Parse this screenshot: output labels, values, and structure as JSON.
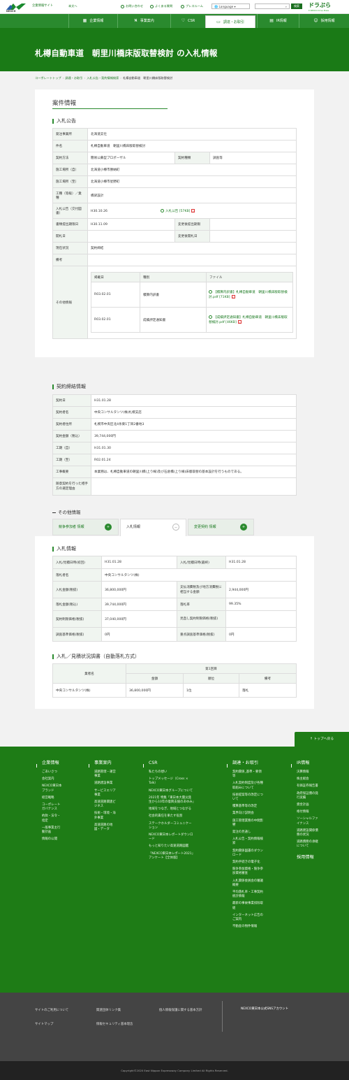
{
  "header": {
    "logo_text": "NEXCO",
    "corp_site": "企業情報サイト",
    "home": "本文へ",
    "util": [
      "お問い合わせ",
      "よくある質問",
      "プレスルーム"
    ],
    "language": "Language",
    "search_button": "検索",
    "drapura": "ドラぷら",
    "drapura_sub": "E-NEXCO Drive Plaza"
  },
  "nav": [
    {
      "label": "企業情報",
      "icon": "▦"
    },
    {
      "label": "事業案内",
      "icon": "⛕"
    },
    {
      "label": "CSR",
      "icon": "♡"
    },
    {
      "label": "調達・お取引",
      "icon": "▭"
    },
    {
      "label": "IR情報",
      "icon": "▤"
    },
    {
      "label": "採用情報",
      "icon": "☺"
    }
  ],
  "page": {
    "title": "札樽自動車道　朝里川橋床版取替検討 の入札情報",
    "breadcrumb": [
      "コーポレートトップ",
      "調達・お取引",
      "入札公告・契約情報検索",
      "札樽自動車道　朝里川橋床版取替検討"
    ]
  },
  "case": {
    "heading": "案件情報",
    "sub": "入札公告",
    "rows": [
      {
        "label": "発注事業所",
        "value": "北海道支社"
      },
      {
        "label": "件名",
        "value": "札樽自動車道　朝里川橋床版取替検討"
      },
      {
        "label": "契約方法",
        "value": "簡易公募型プロポーザル",
        "label2": "契約種類",
        "value2": "調査等"
      },
      {
        "label": "施工場所（自）",
        "value": "北海道小樽市勝納町"
      },
      {
        "label": "施工場所（至）",
        "value": "北海道小樽市星野町"
      },
      {
        "label": "工種（等級）／業種",
        "value": "橋梁設計"
      },
      {
        "label": "入札公告（交付図書）",
        "value": "H30.10.26",
        "link": "入札公告 [57KB]"
      },
      {
        "label": "書類提出期限日",
        "value": "H30.11.09",
        "label2": "変更後提出期限",
        "value2": ""
      },
      {
        "label": "開札日",
        "value": "",
        "label2": "変更後開札日",
        "value2": ""
      },
      {
        "label": "現在状況",
        "value": "契約締結"
      },
      {
        "label": "備考",
        "value": ""
      }
    ],
    "other_label": "その他情報",
    "other_headers": [
      "掲載日",
      "種別",
      "ファイル"
    ],
    "other_rows": [
      {
        "date": "R03.02.01",
        "type": "積算内訳書",
        "file": "【積算内訳書】札樽自動車道　朝里川橋床版取替検討.pdf [71KB]"
      },
      {
        "date": "R03.02.01",
        "type": "成績評定通知書",
        "file": "【成績評定通知書】札樽自動車道　朝里川橋床版取替検討.pdf [46KB]"
      }
    ]
  },
  "contract": {
    "heading": "契約締結情報",
    "rows": [
      {
        "label": "契約日",
        "value": "H31.01.28"
      },
      {
        "label": "契約者名",
        "value": "中央コンサルタンツ(株)札幌支店"
      },
      {
        "label": "契約者住所",
        "value": "札幌市中央区北4条東1丁目2番地3"
      },
      {
        "label": "契約金額（税込）",
        "value": "39,744,000円"
      },
      {
        "label": "工期（自）",
        "value": "H31.01.30"
      },
      {
        "label": "工期（至）",
        "value": "R02.01.24"
      },
      {
        "label": "工事概要",
        "value": "本業務は、札樽自動車道の朝里川橋(上り線)及び石倉橋(上り線)床版取替の基本設計を行うものである。"
      },
      {
        "label": "随意契約を行った相手方の選定理由",
        "value": ""
      }
    ]
  },
  "other": {
    "heading": "その他情報",
    "tabs": [
      "競争参加者 情報",
      "入札情報",
      "変更契約 情報"
    ]
  },
  "bid": {
    "heading": "入札情報",
    "rows": [
      {
        "label": "入札/見積日時(初回)",
        "value": "H31.01.28",
        "label2": "入札/見積日時(最終)",
        "value2": "H31.01.28"
      },
      {
        "label": "落札者名",
        "value": "中央コンサルタンツ(株)"
      },
      {
        "label": "入札金額(税抜)",
        "value": "36,800,000円",
        "label2": "支払消費税及び地方消費税に相当する金額",
        "value2": "2,944,000円"
      },
      {
        "label": "落札金額(税込)",
        "value": "39,744,000円",
        "label2": "落札率",
        "value2": "99.35%"
      },
      {
        "label": "契約制限価格(税抜)",
        "value": "37,040,000円",
        "label2": "見直し契約制限価格(税抜)",
        "value2": ""
      },
      {
        "label": "調査基準価格(税抜)",
        "value": "0円",
        "label2": "重点調査基準価格(税抜)",
        "value2": "0円"
      }
    ]
  },
  "tender": {
    "heading": "入札／見積状況調書（自動落札方式）",
    "h_company": "業者名",
    "h_round": "第1回目",
    "h_cols": [
      "金額",
      "順位",
      "備考"
    ],
    "rows": [
      {
        "company": "中央コンサルタンツ(株)",
        "amount": "36,800,000円",
        "rank": "1位",
        "note": "落札"
      }
    ]
  },
  "top_button": "トップへ戻る",
  "footer": {
    "cols": [
      {
        "head": "企業情報",
        "links": [
          "ごあいさつ",
          "会社案内",
          "NEXCO東日本ブランド",
          "経営戦略",
          "コーポレートガバナンス",
          "約款・法令・指定",
          "一般事業主行動計画",
          "情報の公開"
        ]
      },
      {
        "head": "事業案内",
        "links": [
          "道路管理・運営事業",
          "道路建設事業",
          "サービスエリア事業",
          "高速道路関連ビジネス",
          "技術・環境・海外事業",
          "高速道路の地図・データ"
        ]
      },
      {
        "head": "CSR",
        "links": [
          "私たちの想い",
          "トップメッセージ（Cross × Talk）",
          "NEXCO東日本グループについて",
          "2021年 特集「東日本大震災発生から10年の復興支援のあゆみ」",
          "地域をつなぎ、地域とつながる",
          "社会的責任を果たす役割",
          "ステークホルダーコミュニケーション",
          "NEXCO東日本レポートダウンロード",
          "もっと知りたい高速道路図鑑",
          "「NEXCO東日本レポート2021」アンケート【全体版】"
        ]
      },
      {
        "head": "調達・お取引",
        "links": [
          "契約関係_基準・要領等",
          "入札契約制度及び各種取組みについて",
          "技術提案等の改定について",
          "積算基準等の改定",
          "業界向け説明会",
          "施工管理業務の中間影響",
          "発注の見通し",
          "入札公告・契約情報検索",
          "契約関係図書のダウンロード",
          "契約手続きの電子化",
          "競争参加資格・競争参加資格審査",
          "入札関係委員会の審議概要",
          "平均落札率・工事契約統計情報",
          "最新の事故事業排除取組",
          "インターネット広告のご案内",
          "不動産の物件情報"
        ]
      },
      {
        "head": "IR情報",
        "links": [
          "決算情報",
          "株主総会",
          "有価証券報告書",
          "政府保証債の発行実績",
          "資金計画",
          "格付情報",
          "ソーシャルファイナンス",
          "道路建設関係債務の状況",
          "道路債務の承継について"
        ],
        "head2": "採用情報"
      }
    ],
    "bottom": [
      "サイトのご利用について",
      "関連団体リンク集",
      "個人情報保護に関する基本方針",
      "サイトマップ",
      "情報セキュリティ基本理念"
    ],
    "sns": "NEXCO東日本公式SNSアカウント",
    "copyright": "Copyright©2020 East Nippon Expressway Company Limited All Rights Reserved."
  },
  "colors": {
    "brand_green": "#1a7a16",
    "nav_green": "#2a8a2e",
    "pdf_red": "#dd3333"
  }
}
